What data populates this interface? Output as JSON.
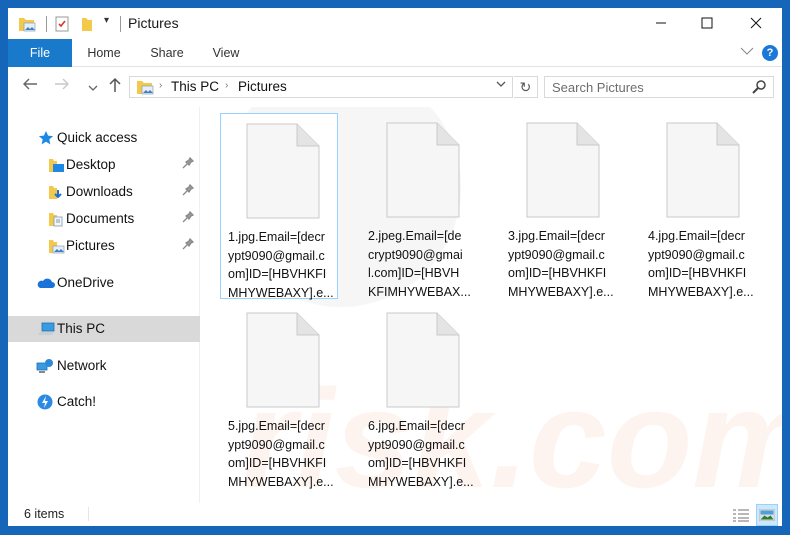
{
  "window": {
    "title": "Pictures",
    "controls": {
      "minimize": "—",
      "maximize": "☐",
      "close": "✕"
    }
  },
  "ribbon": {
    "tabs": [
      {
        "label": "File",
        "active": true
      },
      {
        "label": "Home"
      },
      {
        "label": "Share"
      },
      {
        "label": "View"
      }
    ],
    "help_label": "?"
  },
  "navigation": {
    "back": "←",
    "forward": "→",
    "recent": "⌄",
    "up": "↑",
    "breadcrumb": [
      "This PC",
      "Pictures"
    ],
    "crumb_separator": "›",
    "refresh": "↻",
    "search_placeholder": "Search Pictures"
  },
  "sidebar": {
    "items": [
      {
        "label": "Quick access",
        "icon": "star-icon",
        "pinned": false,
        "selected": false
      },
      {
        "label": "Desktop",
        "icon": "desktop-folder-icon",
        "pinned": true,
        "selected": false
      },
      {
        "label": "Downloads",
        "icon": "downloads-folder-icon",
        "pinned": true,
        "selected": false
      },
      {
        "label": "Documents",
        "icon": "documents-folder-icon",
        "pinned": true,
        "selected": false
      },
      {
        "label": "Pictures",
        "icon": "pictures-folder-icon",
        "pinned": true,
        "selected": false
      },
      {
        "label": "OneDrive",
        "icon": "cloud-icon",
        "pinned": false,
        "selected": false
      },
      {
        "label": "This PC",
        "icon": "computer-icon",
        "pinned": false,
        "selected": true
      },
      {
        "label": "Network",
        "icon": "network-icon",
        "pinned": false,
        "selected": false
      },
      {
        "label": "Catch!",
        "icon": "catch-icon",
        "pinned": false,
        "selected": false
      }
    ]
  },
  "files": [
    {
      "name_lines": [
        "1.jpg.Email=[decr",
        "ypt9090@gmail.c",
        "om]ID=[HBVHKFI",
        "MHYWEBAXY].e..."
      ],
      "focused": true
    },
    {
      "name_lines": [
        "2.jpeg.Email=[de",
        "crypt9090@gmai",
        "l.com]ID=[HBVH",
        "KFIMHYWEBAX..."
      ],
      "focused": false
    },
    {
      "name_lines": [
        "3.jpg.Email=[decr",
        "ypt9090@gmail.c",
        "om]ID=[HBVHKFI",
        "MHYWEBAXY].e..."
      ],
      "focused": false
    },
    {
      "name_lines": [
        "4.jpg.Email=[decr",
        "ypt9090@gmail.c",
        "om]ID=[HBVHKFI",
        "MHYWEBAXY].e..."
      ],
      "focused": false
    },
    {
      "name_lines": [
        "5.jpg.Email=[decr",
        "ypt9090@gmail.c",
        "om]ID=[HBVHKFI",
        "MHYWEBAXY].e..."
      ],
      "focused": false
    },
    {
      "name_lines": [
        "6.jpg.Email=[decr",
        "ypt9090@gmail.c",
        "om]ID=[HBVHKFI",
        "MHYWEBAXY].e..."
      ],
      "focused": false
    }
  ],
  "status": {
    "item_count": "6 items",
    "views": [
      {
        "name": "details-view",
        "active": false
      },
      {
        "name": "large-icons-view",
        "active": true
      }
    ]
  },
  "colors": {
    "frame": "#1565b8",
    "file_tab": "#1979ca",
    "selection": "#d9d9d9",
    "focus_border": "#99d1ff",
    "help": "#1b78d8"
  }
}
